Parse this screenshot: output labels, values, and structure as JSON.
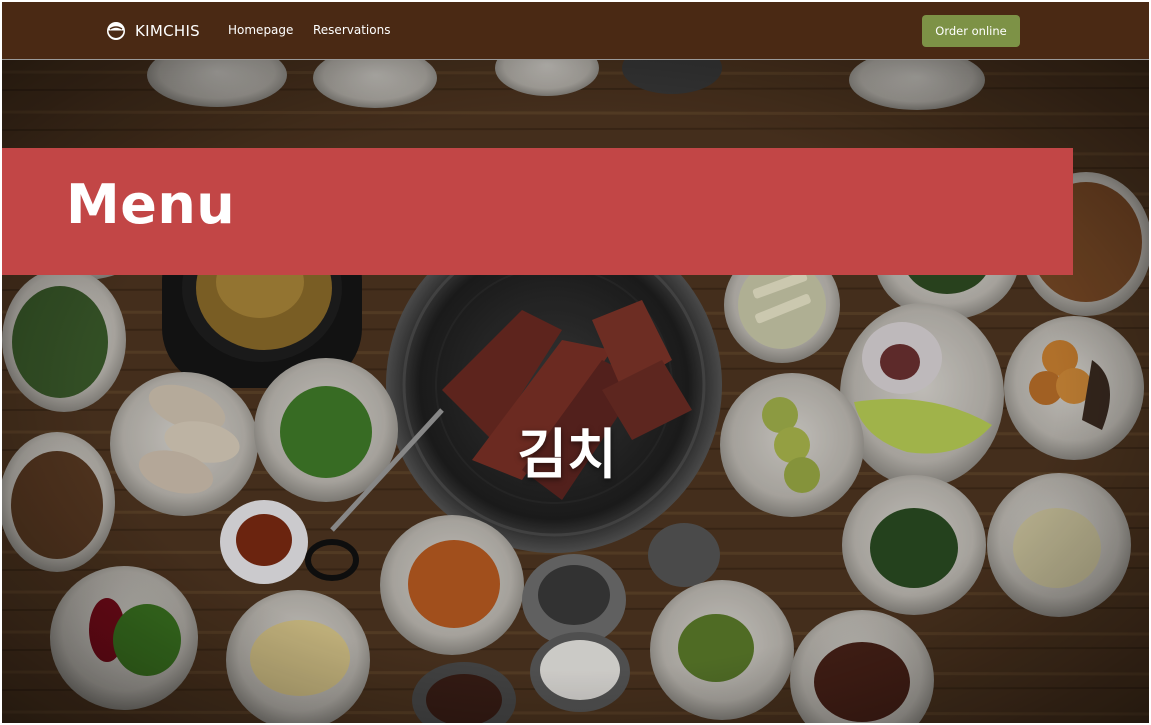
{
  "navbar": {
    "brand": "KIMCHIS",
    "links": [
      "Homepage",
      "Reservations"
    ],
    "order_button": "Order online"
  },
  "hero": {
    "title": "Menu",
    "hangul": "김치"
  },
  "icons": {
    "brand": "rice-bowl-icon"
  },
  "colors": {
    "navbar_bg": "#4a2914",
    "menu_band": "#c24646",
    "order_button": "#7d9246"
  }
}
